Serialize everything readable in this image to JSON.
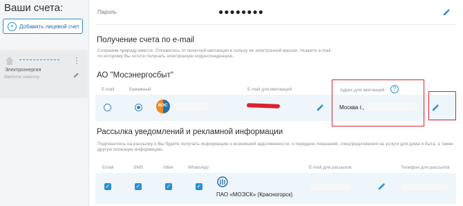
{
  "sidebar": {
    "title": "Ваши счета:",
    "add_button": "Добавить лицевой счет",
    "account": {
      "service": "Электроэнергия",
      "note_placeholder": "Введите заметку"
    }
  },
  "password": {
    "label": "Пароль",
    "value": "●●●●●●●●"
  },
  "email_section": {
    "title": "Получение счета по e-mail",
    "description": "Сохраним природу вместе. Откажитесь от печатной квитанции в пользу ее электронной версии. Укажите e-mail, по которому Вы хотите получать электронную корреспонденцию."
  },
  "mes": {
    "title": "АО \"Мосэнергосбыт\"",
    "col_email": "E-mail",
    "col_paper": "Бумажный",
    "col_receipt_email": "E-mail для квитанций",
    "col_address": "Адрес для квитанций",
    "help_glyph": "?",
    "address_value": "Москва г.,",
    "logo_text": "МЭС",
    "selected": "paper"
  },
  "mailing": {
    "title": "Рассылка уведомлений и рекламной информации",
    "description": "Подпишитесь на рассылку и Вы будете получать информацию о возникшей задолженности, о передаче показаний, спецпредложения на услуги для дома и быта, а также другую полезную информацию.",
    "col_email": "Email",
    "col_sms": "SMS",
    "col_viber": "Viber",
    "col_whatsapp": "WhatsApp",
    "col_mail_email": "E-mail для рассылок",
    "col_phone": "Телефон для рассылок",
    "company": "ПАО «МОЭСК» (Красногорск)",
    "checked": [
      true,
      true,
      true,
      true
    ]
  },
  "colors": {
    "accent": "#2a8fd0",
    "highlight": "#d9232e",
    "row_bg": "#eef5fb"
  }
}
